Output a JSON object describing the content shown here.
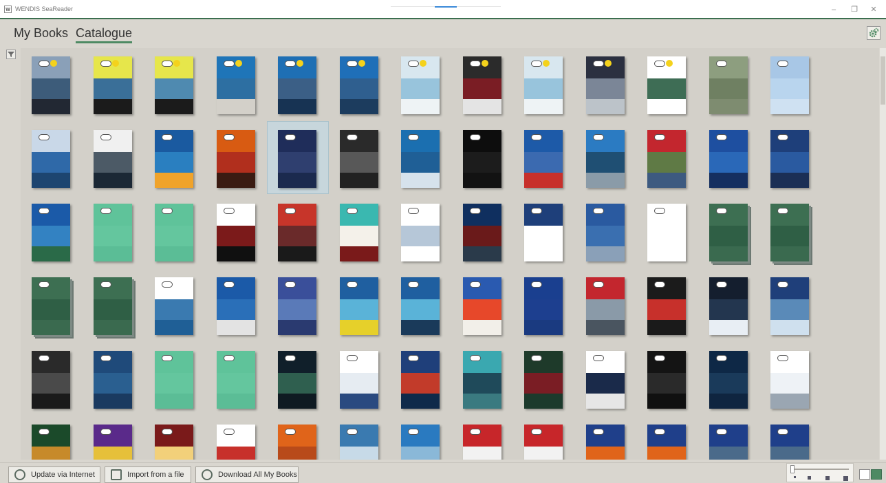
{
  "window": {
    "title": "WENDIS SeaReader"
  },
  "tabs": [
    {
      "label": "My Books",
      "active": false
    },
    {
      "label": "Catalogue",
      "active": true
    }
  ],
  "footer": {
    "update_label": "Update via Internet",
    "import_label": "Import from a file",
    "download_label": "Download All My Books"
  },
  "colors": {
    "accent": "#4e8a63",
    "selection": "#c7d6dc",
    "background": "#d9d6cf"
  },
  "catalogue": {
    "icons": {
      "availability": "cloud-download-icon",
      "new_marker": "sun-badge-icon"
    },
    "books": [
      {
        "top": "#8aa0b8",
        "mid": "#3d5c7a",
        "bot": "#222833",
        "sun": true,
        "stack": false
      },
      {
        "top": "#e6e64b",
        "mid": "#3a6f98",
        "bot": "#1b1b1b",
        "sun": true,
        "stack": false
      },
      {
        "top": "#e6e64b",
        "mid": "#4f8ab0",
        "bot": "#1b1b1b",
        "sun": true,
        "stack": false
      },
      {
        "top": "#1f75b8",
        "mid": "#2d6fa2",
        "bot": "#d3d0c9",
        "sun": true,
        "stack": false
      },
      {
        "top": "#1e6fb4",
        "mid": "#3b5f86",
        "bot": "#173353",
        "sun": true,
        "stack": false
      },
      {
        "top": "#1f6fb8",
        "mid": "#2f5f8f",
        "bot": "#1c3c5e",
        "sun": true,
        "stack": false
      },
      {
        "top": "#d8e7ef",
        "mid": "#98c4dc",
        "bot": "#eef3f5",
        "sun": true,
        "stack": false
      },
      {
        "top": "#2b2b2b",
        "mid": "#7a1d24",
        "bot": "#e4e4e4",
        "sun": true,
        "stack": false
      },
      {
        "top": "#d8e7ef",
        "mid": "#98c4dc",
        "bot": "#eef3f5",
        "sun": true,
        "stack": false
      },
      {
        "top": "#2b3040",
        "mid": "#7b8697",
        "bot": "#bcc3c9",
        "sun": true,
        "stack": false
      },
      {
        "top": "#ffffff",
        "mid": "#3e6d55",
        "bot": "#ffffff",
        "sun": true,
        "stack": false
      },
      {
        "top": "#8d9e7f",
        "mid": "#6f8062",
        "bot": "#7e8c70",
        "sun": false,
        "stack": false
      },
      {
        "top": "#a8c7e6",
        "mid": "#b9d5ee",
        "bot": "#cfe1f2",
        "sun": false,
        "stack": false
      },
      {
        "top": "#c9d8e8",
        "mid": "#2f69a8",
        "bot": "#1d4570",
        "sun": false,
        "stack": false
      },
      {
        "top": "#f0f0f0",
        "mid": "#4c5a66",
        "bot": "#1b2835",
        "sun": false,
        "stack": false
      },
      {
        "top": "#1a5aa0",
        "mid": "#2a7fc0",
        "bot": "#f0a32a",
        "sun": false,
        "stack": false
      },
      {
        "top": "#d85b12",
        "mid": "#b12f1d",
        "bot": "#3a1b12",
        "sun": false,
        "stack": false
      },
      {
        "top": "#1f2d5a",
        "mid": "#2f3f6f",
        "bot": "#1b2a4e",
        "sun": false,
        "stack": false
      },
      {
        "top": "#2a2a2a",
        "mid": "#585858",
        "bot": "#222222",
        "sun": false,
        "stack": false
      },
      {
        "top": "#1b6fb0",
        "mid": "#1f5f96",
        "bot": "#d6e2ec",
        "sun": false,
        "stack": false
      },
      {
        "top": "#0d0d0d",
        "mid": "#1c1c1c",
        "bot": "#121212",
        "sun": false,
        "stack": false
      },
      {
        "top": "#1d5aa8",
        "mid": "#3b6ab0",
        "bot": "#c7302b",
        "sun": false,
        "stack": false
      },
      {
        "top": "#2b7bc2",
        "mid": "#1f4f73",
        "bot": "#8a9ba8",
        "sun": false,
        "stack": false
      },
      {
        "top": "#c3262e",
        "mid": "#5f7a45",
        "bot": "#3d5a80",
        "sun": false,
        "stack": false
      },
      {
        "top": "#1e4fa0",
        "mid": "#2a68b8",
        "bot": "#152f60",
        "sun": false,
        "stack": false
      },
      {
        "top": "#1e3f7a",
        "mid": "#2a5aa0",
        "bot": "#1b2f55",
        "sun": false,
        "stack": false
      },
      {
        "top": "#1b5aa8",
        "mid": "#3382c2",
        "bot": "#2a6a48",
        "sun": false,
        "stack": false
      },
      {
        "top": "#5fc39a",
        "mid": "#64c69e",
        "bot": "#5bbd96",
        "sun": false,
        "stack": false
      },
      {
        "top": "#5fc39a",
        "mid": "#64c69e",
        "bot": "#5bbd96",
        "sun": false,
        "stack": false
      },
      {
        "top": "#ffffff",
        "mid": "#7b1a1a",
        "bot": "#101010",
        "sun": false,
        "stack": false
      },
      {
        "top": "#c7352a",
        "mid": "#6a2a2a",
        "bot": "#1a1a1a",
        "sun": false,
        "stack": false
      },
      {
        "top": "#3ab8b0",
        "mid": "#f4f1ea",
        "bot": "#7a1a1a",
        "sun": false,
        "stack": false
      },
      {
        "top": "#ffffff",
        "mid": "#b6c7d8",
        "bot": "#ffffff",
        "sun": false,
        "stack": false
      },
      {
        "top": "#0f2f5f",
        "mid": "#6a1a1a",
        "bot": "#2a3a4a",
        "sun": false,
        "stack": false
      },
      {
        "top": "#1e3f7a",
        "mid": "#ffffff",
        "bot": "#ffffff",
        "sun": false,
        "stack": false
      },
      {
        "top": "#2a5aa0",
        "mid": "#3a6fb0",
        "bot": "#8aa0b8",
        "sun": false,
        "stack": false
      },
      {
        "top": "#ffffff",
        "mid": "#ffffff",
        "bot": "#ffffff",
        "sun": false,
        "stack": false
      },
      {
        "top": "#3d6f52",
        "mid": "#2f5f45",
        "bot": "#3a6a4f",
        "sun": false,
        "stack": true
      },
      {
        "top": "#3d6f52",
        "mid": "#2f5f45",
        "bot": "#3a6a4f",
        "sun": false,
        "stack": true
      },
      {
        "top": "#3d6f52",
        "mid": "#2f5f45",
        "bot": "#3a6a4f",
        "sun": false,
        "stack": true
      },
      {
        "top": "#3d6f52",
        "mid": "#2f5f45",
        "bot": "#3a6a4f",
        "sun": false,
        "stack": true
      },
      {
        "top": "#ffffff",
        "mid": "#3a7ab0",
        "bot": "#1f5f96",
        "sun": false,
        "stack": false
      },
      {
        "top": "#1b5aa8",
        "mid": "#2a6fb8",
        "bot": "#e3e3e3",
        "sun": false,
        "stack": false
      },
      {
        "top": "#3a4f9a",
        "mid": "#5a7ab8",
        "bot": "#2a3a70",
        "sun": false,
        "stack": false
      },
      {
        "top": "#1f5fa0",
        "mid": "#5ab3d8",
        "bot": "#e6d02a",
        "sun": false,
        "stack": false
      },
      {
        "top": "#1f5fa0",
        "mid": "#5ab3d8",
        "bot": "#1a3a5a",
        "sun": false,
        "stack": false
      },
      {
        "top": "#2a5ab0",
        "mid": "#e7482a",
        "bot": "#f2efe9",
        "sun": false,
        "stack": false
      },
      {
        "top": "#1a3f8f",
        "mid": "#1d3f8f",
        "bot": "#1a3a80",
        "sun": false,
        "stack": false
      },
      {
        "top": "#c3262e",
        "mid": "#8a9aa8",
        "bot": "#4a5560",
        "sun": false,
        "stack": false
      },
      {
        "top": "#1b1b1b",
        "mid": "#c7302b",
        "bot": "#1a1a1a",
        "sun": false,
        "stack": false
      },
      {
        "top": "#141e2e",
        "mid": "#23364f",
        "bot": "#e8eef4",
        "sun": false,
        "stack": false
      },
      {
        "top": "#1f3f7a",
        "mid": "#5a8ab8",
        "bot": "#cfe0ee",
        "sun": false,
        "stack": false
      },
      {
        "top": "#2a2a2a",
        "mid": "#4a4a4a",
        "bot": "#1a1a1a",
        "sun": false,
        "stack": false
      },
      {
        "top": "#1f4a7a",
        "mid": "#2a5f90",
        "bot": "#1a3a60",
        "sun": false,
        "stack": false
      },
      {
        "top": "#5fc39a",
        "mid": "#64c69e",
        "bot": "#5bbd96",
        "sun": false,
        "stack": false
      },
      {
        "top": "#5fc39a",
        "mid": "#64c69e",
        "bot": "#5bbd96",
        "sun": false,
        "stack": false
      },
      {
        "top": "#101f2a",
        "mid": "#2f5f4f",
        "bot": "#0f1a22",
        "sun": false,
        "stack": false
      },
      {
        "top": "#ffffff",
        "mid": "#e6ecf2",
        "bot": "#2a4a80",
        "sun": false,
        "stack": false
      },
      {
        "top": "#1f3f7a",
        "mid": "#c23b2a",
        "bot": "#0f2a4a",
        "sun": false,
        "stack": false
      },
      {
        "top": "#3aa8b0",
        "mid": "#1f4a5a",
        "bot": "#3a7a80",
        "sun": false,
        "stack": false
      },
      {
        "top": "#1e3a2a",
        "mid": "#7a1d24",
        "bot": "#1c3a2c",
        "sun": false,
        "stack": false
      },
      {
        "top": "#ffffff",
        "mid": "#1a2a4a",
        "bot": "#e6e6e6",
        "sun": false,
        "stack": false
      },
      {
        "top": "#141414",
        "mid": "#2a2a2a",
        "bot": "#101010",
        "sun": false,
        "stack": false
      },
      {
        "top": "#0e2846",
        "mid": "#1a3a5a",
        "bot": "#0f2540",
        "sun": false,
        "stack": false
      },
      {
        "top": "#ffffff",
        "mid": "#eef2f6",
        "bot": "#9aa6b2",
        "sun": false,
        "stack": false
      },
      {
        "top": "#1b4a2a",
        "mid": "#c78a2a",
        "bot": "#1a3020",
        "sun": false,
        "stack": false
      },
      {
        "top": "#5a2a8a",
        "mid": "#e6c03a",
        "bot": "#3a1a6a",
        "sun": false,
        "stack": false
      },
      {
        "top": "#7a1a1a",
        "mid": "#f2d07a",
        "bot": "#5a1010",
        "sun": false,
        "stack": false
      },
      {
        "top": "#ffffff",
        "mid": "#c7302b",
        "bot": "#1a3a6a",
        "sun": false,
        "stack": false
      },
      {
        "top": "#e0641a",
        "mid": "#b84a1a",
        "bot": "#2a1a10",
        "sun": false,
        "stack": false
      },
      {
        "top": "#3a7ab0",
        "mid": "#c7dae8",
        "bot": "#ffffff",
        "sun": false,
        "stack": false
      },
      {
        "top": "#2a7ac0",
        "mid": "#8ab8d8",
        "bot": "#dfe9f0",
        "sun": false,
        "stack": false
      },
      {
        "top": "#c7262a",
        "mid": "#f2f2f2",
        "bot": "#2a2a2a",
        "sun": false,
        "stack": false
      },
      {
        "top": "#c7262a",
        "mid": "#f2f2f2",
        "bot": "#2a2a2a",
        "sun": false,
        "stack": false
      },
      {
        "top": "#1f3f8a",
        "mid": "#e0641a",
        "bot": "#2a2a2a",
        "sun": false,
        "stack": false
      },
      {
        "top": "#1f3f8a",
        "mid": "#e0641a",
        "bot": "#2a2a2a",
        "sun": false,
        "stack": false
      },
      {
        "top": "#1f3f8a",
        "mid": "#4a6a8a",
        "bot": "#2a3a4a",
        "sun": false,
        "stack": false
      },
      {
        "top": "#1f3f8a",
        "mid": "#4a6a8a",
        "bot": "#2a3a4a",
        "sun": false,
        "stack": false
      }
    ]
  }
}
